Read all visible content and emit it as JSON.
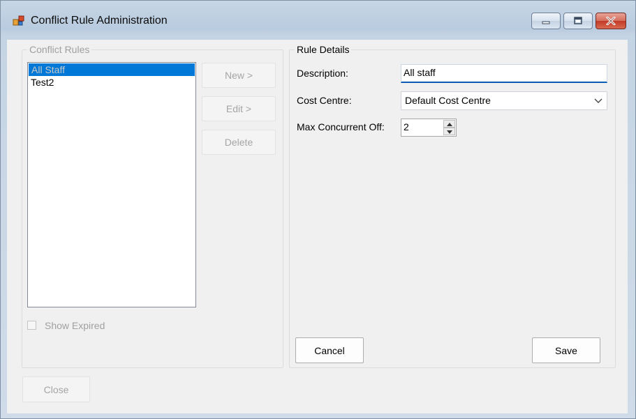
{
  "window": {
    "title": "Conflict Rule Administration",
    "icons": {
      "app": "app-icon",
      "minimize": "minimize-icon",
      "maximize": "maximize-icon",
      "close": "close-icon"
    }
  },
  "conflict_rules": {
    "legend": "Conflict Rules",
    "items": [
      {
        "label": "All Staff",
        "selected": true
      },
      {
        "label": "Test2",
        "selected": false
      }
    ],
    "new_label": "New >",
    "edit_label": "Edit >",
    "delete_label": "Delete",
    "show_expired_label": "Show Expired",
    "show_expired_checked": false
  },
  "rule_details": {
    "legend": "Rule Details",
    "description_label": "Description:",
    "description_value": "All staff",
    "cost_centre_label": "Cost Centre:",
    "cost_centre_value": "Default Cost Centre",
    "max_concurrent_label": "Max Concurrent Off:",
    "max_concurrent_value": "2",
    "cancel_label": "Cancel",
    "save_label": "Save"
  },
  "footer": {
    "close_label": "Close"
  },
  "colors": {
    "selection": "#0078d7",
    "focus_underline": "#0d5cb3",
    "close_button": "#c13a27"
  }
}
